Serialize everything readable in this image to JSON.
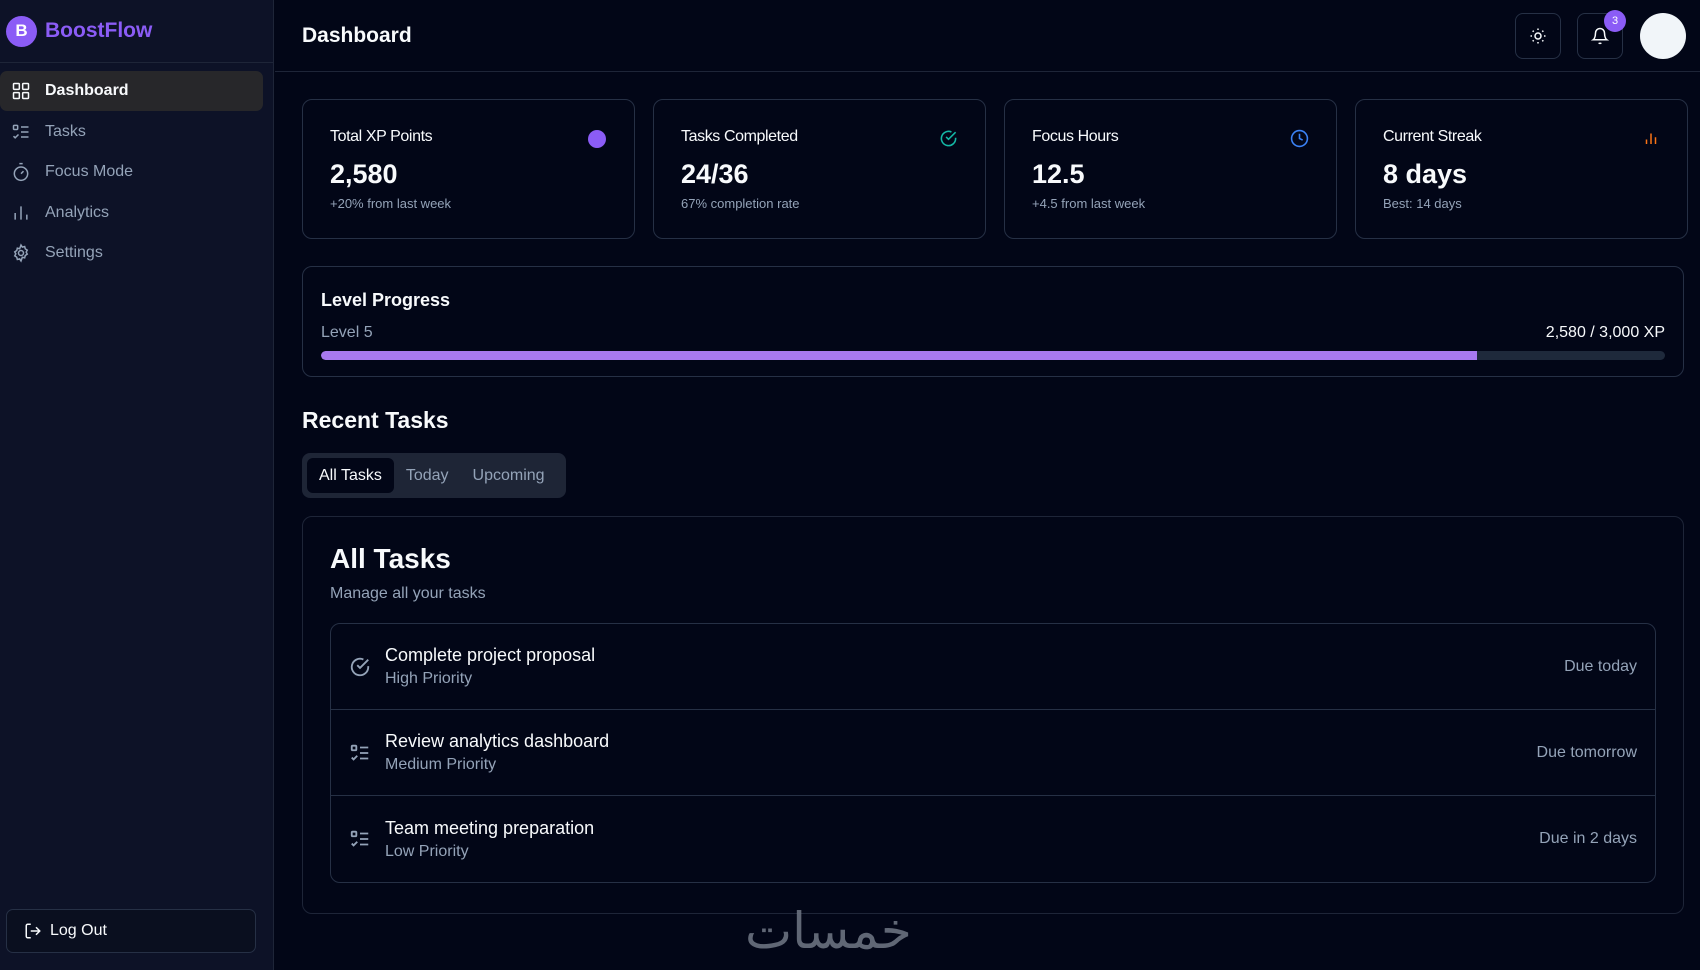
{
  "app": {
    "name": "BoostFlow",
    "logo_letter": "B",
    "accent": "#8b5cf6"
  },
  "sidebar": {
    "items": [
      {
        "label": "Dashboard",
        "icon": "grid-icon",
        "active": true
      },
      {
        "label": "Tasks",
        "icon": "checklist-icon"
      },
      {
        "label": "Focus Mode",
        "icon": "timer-icon"
      },
      {
        "label": "Analytics",
        "icon": "bar-chart-icon"
      },
      {
        "label": "Settings",
        "icon": "gear-icon"
      }
    ],
    "logout_label": "Log Out"
  },
  "header": {
    "title": "Dashboard",
    "notification_count": "3"
  },
  "stats": [
    {
      "label": "Total XP Points",
      "value": "2,580",
      "sub": "+20% from last week",
      "icon": "purple-dot-icon",
      "color": "#8b5cf6"
    },
    {
      "label": "Tasks Completed",
      "value": "24/36",
      "sub": "67% completion rate",
      "icon": "check-circle-icon",
      "color": "#14b8a6"
    },
    {
      "label": "Focus Hours",
      "value": "12.5",
      "sub": "+4.5 from last week",
      "icon": "clock-icon",
      "color": "#3b82f6"
    },
    {
      "label": "Current Streak",
      "value": "8 days",
      "sub": "Best: 14 days",
      "icon": "bar-chart-icon",
      "color": "#f97316"
    }
  ],
  "level": {
    "title": "Level Progress",
    "level_label": "Level 5",
    "xp_label": "2,580 / 3,000 XP",
    "progress": 0.86
  },
  "recent": {
    "title": "Recent Tasks",
    "tabs": [
      "All Tasks",
      "Today",
      "Upcoming"
    ],
    "panel_title": "All Tasks",
    "panel_sub": "Manage all your tasks",
    "tasks": [
      {
        "title": "Complete project proposal",
        "priority": "High Priority",
        "due": "Due today",
        "icon": "check-circle-icon"
      },
      {
        "title": "Review analytics dashboard",
        "priority": "Medium Priority",
        "due": "Due tomorrow",
        "icon": "checklist-icon"
      },
      {
        "title": "Team meeting preparation",
        "priority": "Low Priority",
        "due": "Due in 2 days",
        "icon": "checklist-icon"
      }
    ]
  },
  "watermark": "خمسات"
}
